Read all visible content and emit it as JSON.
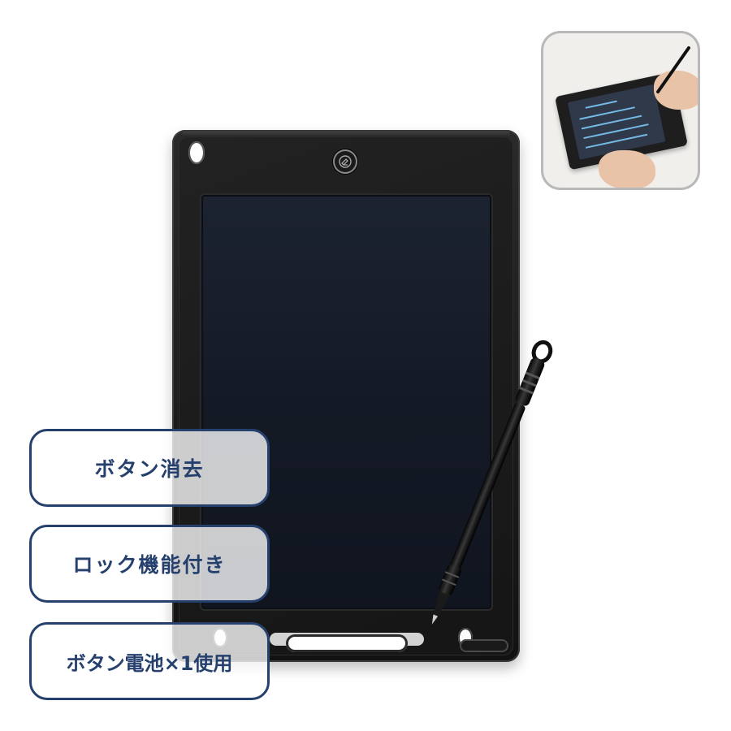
{
  "product": {
    "icons": {
      "erase_button": "eraser-icon"
    },
    "colors": {
      "pill_border": "#26406e",
      "pill_text": "#26406e",
      "tablet_body": "#1b1b1b",
      "screen": "#141a25",
      "inset_border": "#b9b9b9"
    }
  },
  "features": [
    {
      "label": "ボタン消去"
    },
    {
      "label": "ロック機能付き"
    },
    {
      "label": "ボタン電池×1使用"
    }
  ]
}
